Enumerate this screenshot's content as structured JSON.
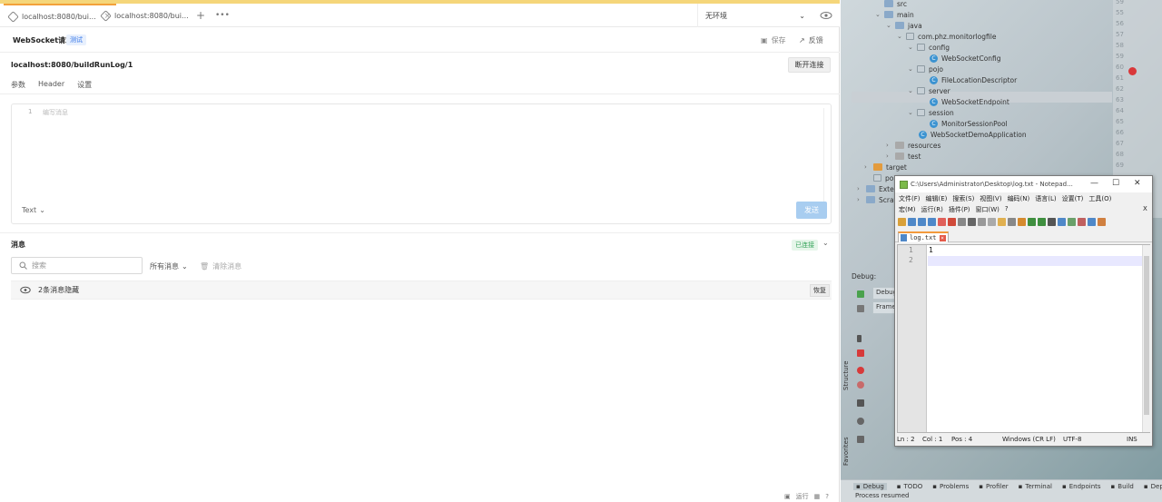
{
  "tabs": [
    {
      "label": "localhost:8080/bui..."
    },
    {
      "label": "localhost:8080/bui..."
    }
  ],
  "env_select": "无环境",
  "ws": {
    "title": "WebSocket请求",
    "badge": "测试",
    "save": "保存",
    "feedback": "反馈",
    "url": "localhost:8080/buildRunLog/1",
    "disconnect": "断开连接",
    "subtabs": [
      "参数",
      "Header",
      "设置"
    ],
    "editor_line": "1",
    "editor_placeholder": "编写消息",
    "format": "Text",
    "send": "发送"
  },
  "messages": {
    "title": "消息",
    "status": "已连接",
    "search_placeholder": "搜索",
    "filter": "所有消息",
    "clear": "清除消息",
    "hidden": "2条消息隐藏",
    "restore": "恢复"
  },
  "footer": {
    "run": "运行"
  },
  "ide": {
    "tree": [
      {
        "label": "src"
      },
      {
        "label": "main"
      },
      {
        "label": "java"
      },
      {
        "label": "com.phz.monitorlogfile"
      },
      {
        "label": "config"
      },
      {
        "label": "WebSocketConfig"
      },
      {
        "label": "pojo"
      },
      {
        "label": "FileLocationDescriptor"
      },
      {
        "label": "server"
      },
      {
        "label": "WebSocketEndpoint"
      },
      {
        "label": "session"
      },
      {
        "label": "MonitorSessionPool"
      },
      {
        "label": "WebSocketDemoApplication"
      },
      {
        "label": "resources"
      },
      {
        "label": "test"
      },
      {
        "label": "target"
      },
      {
        "label": "pom.xml"
      },
      {
        "label": "Extern"
      },
      {
        "label": "Scratc"
      }
    ],
    "gutter": [
      "59",
      "55",
      "56",
      "57",
      "58",
      "59",
      "60",
      "61",
      "62",
      "63",
      "64",
      "65",
      "66",
      "67",
      "68",
      "69"
    ],
    "debug_label": "Debug:",
    "debug_tab": "Debug",
    "frames_tab": "Frames",
    "structure": "Structure",
    "favorites": "Favorites",
    "toolwindows": [
      "Debug",
      "TODO",
      "Problems",
      "Profiler",
      "Terminal",
      "Endpoints",
      "Build",
      "Dep"
    ],
    "status": "Process resumed"
  },
  "notepad": {
    "title": "C:\\Users\\Administrator\\Desktop\\log.txt - Notepad...",
    "menu1": [
      "文件(F)",
      "编辑(E)",
      "搜索(S)",
      "视图(V)",
      "编码(N)",
      "语言(L)",
      "设置(T)",
      "工具(O)"
    ],
    "menu2": [
      "宏(M)",
      "运行(R)",
      "插件(P)",
      "窗口(W)",
      "?"
    ],
    "close_x": "X",
    "tab": "log.txt",
    "lines": [
      "1",
      "2"
    ],
    "line1_text": "1",
    "status": {
      "ln": "Ln : 2",
      "col": "Col : 1",
      "pos": "Pos : 4",
      "eol": "Windows (CR LF)",
      "enc": "UTF-8",
      "ins": "INS"
    }
  }
}
